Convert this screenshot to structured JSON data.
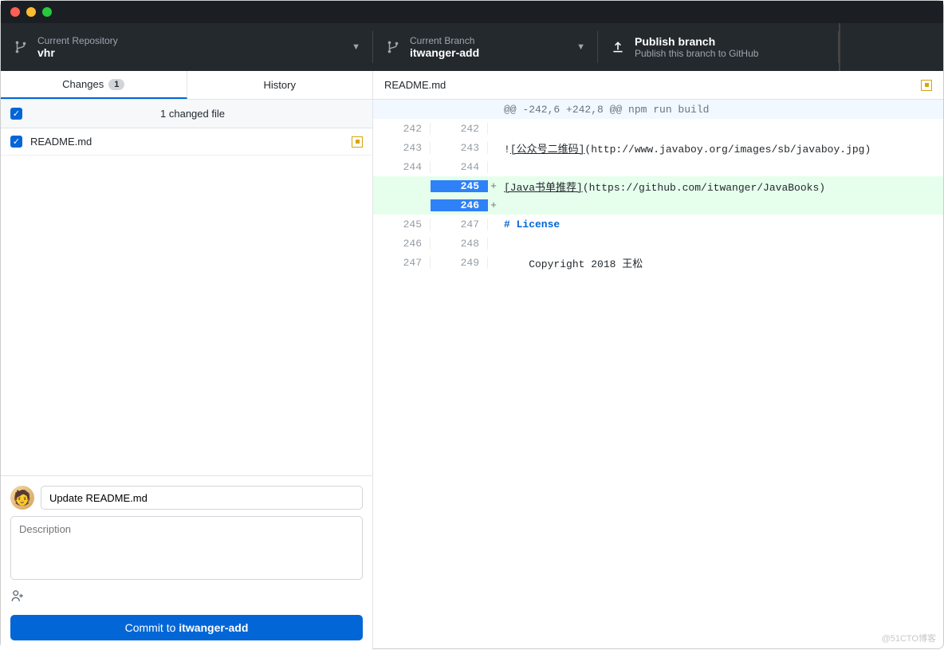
{
  "toolbar": {
    "repo": {
      "label": "Current Repository",
      "value": "vhr"
    },
    "branch": {
      "label": "Current Branch",
      "value": "itwanger-add"
    },
    "publish": {
      "label": "Publish branch",
      "sub": "Publish this branch to GitHub"
    }
  },
  "tabs": {
    "changes": "Changes",
    "changes_count": "1",
    "history": "History"
  },
  "changes": {
    "summary": "1 changed file"
  },
  "files": [
    {
      "name": "README.md"
    }
  ],
  "commit": {
    "summary_value": "Update README.md",
    "desc_placeholder": "Description",
    "button_prefix": "Commit to ",
    "button_branch": "itwanger-add"
  },
  "diff": {
    "filename": "README.md",
    "lines": [
      {
        "type": "hunk",
        "l": "",
        "r": "",
        "code": "@@ -242,6 +242,8 @@ npm run build"
      },
      {
        "type": "ctx",
        "l": "242",
        "r": "242",
        "code": ""
      },
      {
        "type": "ctx",
        "l": "243",
        "r": "243",
        "code": "![公众号二维码](http://www.javaboy.org/images/sb/javaboy.jpg)",
        "linktext": "[公众号二维码]",
        "pre": "!",
        "post": "(http://www.javaboy.org/images/sb/javaboy.jpg)"
      },
      {
        "type": "ctx",
        "l": "244",
        "r": "244",
        "code": ""
      },
      {
        "type": "add",
        "l": "",
        "r": "245",
        "linktext": "[Java书单推荐]",
        "post": "(https://github.com/itwanger/JavaBooks)"
      },
      {
        "type": "add",
        "l": "",
        "r": "246",
        "code": ""
      },
      {
        "type": "ctx",
        "l": "245",
        "r": "247",
        "md_h1": "# License"
      },
      {
        "type": "ctx",
        "l": "246",
        "r": "248",
        "code": ""
      },
      {
        "type": "ctx",
        "l": "247",
        "r": "249",
        "code": "    Copyright 2018 王松"
      }
    ]
  },
  "watermark": "@51CTO博客"
}
